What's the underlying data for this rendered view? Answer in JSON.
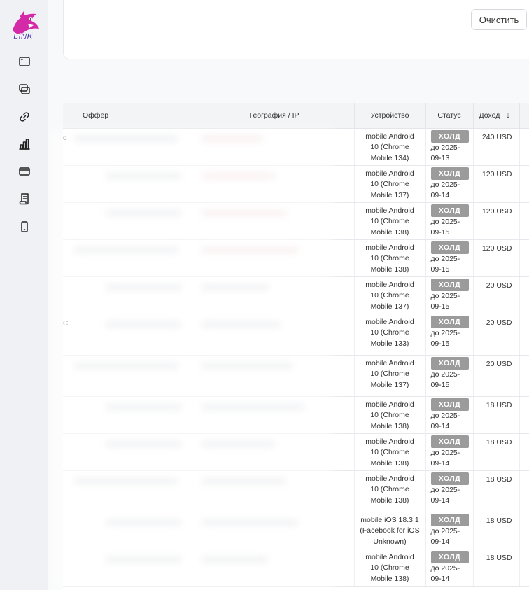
{
  "sidebar": {
    "logo_text": "LINK",
    "items": [
      {
        "icon": "browser-window-icon"
      },
      {
        "icon": "stacked-windows-icon"
      },
      {
        "icon": "link-icon"
      },
      {
        "icon": "bar-chart-icon"
      },
      {
        "icon": "credit-card-icon"
      },
      {
        "icon": "document-icon"
      },
      {
        "icon": "mobile-phone-icon"
      }
    ]
  },
  "filters": {
    "clear_label": "Очистить",
    "accent": "#3a4ee0"
  },
  "table": {
    "headers": {
      "offer": "Оффер",
      "geo": "География / IP",
      "device": "Устройство",
      "status": "Статус",
      "income": "Доход",
      "sort_icon": "arrow-down-icon"
    },
    "rows": [
      {
        "edge": "o",
        "device": [
          "mobile Android",
          "10 (Chrome",
          "Mobile 134)"
        ],
        "status": "ХОЛД",
        "till": [
          "до 2025-",
          "09-13"
        ],
        "income": "240 USD"
      },
      {
        "edge": "",
        "device": [
          "mobile Android",
          "10 (Chrome",
          "Mobile 137)"
        ],
        "status": "ХОЛД",
        "till": [
          "до 2025-",
          "09-14"
        ],
        "income": "120 USD"
      },
      {
        "edge": "",
        "device": [
          "mobile Android",
          "10 (Chrome",
          "Mobile 138)"
        ],
        "status": "ХОЛД",
        "till": [
          "до 2025-",
          "09-15"
        ],
        "income": "120 USD"
      },
      {
        "edge": "",
        "device": [
          "mobile Android",
          "10 (Chrome",
          "Mobile 138)"
        ],
        "status": "ХОЛД",
        "till": [
          "до 2025-",
          "09-15"
        ],
        "income": "120 USD"
      },
      {
        "edge": "",
        "device": [
          "mobile Android",
          "10 (Chrome",
          "Mobile 137)"
        ],
        "status": "ХОЛД",
        "till": [
          "до 2025-",
          "09-15"
        ],
        "income": "20 USD"
      },
      {
        "edge": "C",
        "device": [
          "mobile Android",
          "10 (Chrome",
          "Mobile 133)"
        ],
        "status": "ХОЛД",
        "till": [
          "до 2025-",
          "09-15"
        ],
        "income": "20 USD"
      },
      {
        "edge": "",
        "device": [
          "mobile Android",
          "10 (Chrome",
          "Mobile 137)"
        ],
        "status": "ХОЛД",
        "till": [
          "до 2025-",
          "09-15"
        ],
        "income": "20 USD"
      },
      {
        "edge": "",
        "device": [
          "mobile Android",
          "10 (Chrome",
          "Mobile 138)"
        ],
        "status": "ХОЛД",
        "till": [
          "до 2025-",
          "09-14"
        ],
        "income": "18 USD"
      },
      {
        "edge": "",
        "device": [
          "mobile Android",
          "10 (Chrome",
          "Mobile 138)"
        ],
        "status": "ХОЛД",
        "till": [
          "до 2025-",
          "09-14"
        ],
        "income": "18 USD"
      },
      {
        "edge": "",
        "device": [
          "mobile Android",
          "10 (Chrome",
          "Mobile 138)"
        ],
        "status": "ХОЛД",
        "till": [
          "до 2025-",
          "09-14"
        ],
        "income": "18 USD"
      },
      {
        "edge": "",
        "device": [
          "mobile iOS 18.3.1",
          "(Facebook for iOS",
          "Unknown)"
        ],
        "status": "ХОЛД",
        "till": [
          "до 2025-",
          "09-14"
        ],
        "income": "18 USD"
      },
      {
        "edge": "",
        "device": [
          "mobile Android",
          "10 (Chrome",
          "Mobile 138)"
        ],
        "status": "ХОЛД",
        "till": [
          "до 2025-",
          "09-14"
        ],
        "income": "18 USD"
      }
    ]
  }
}
